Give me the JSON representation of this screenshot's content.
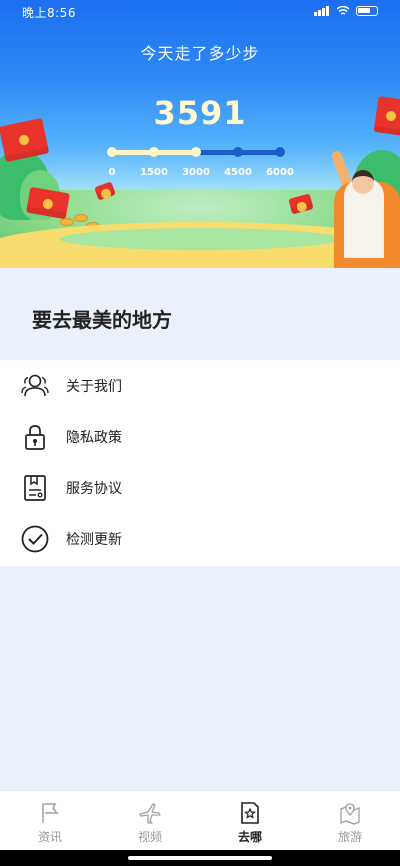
{
  "status_bar": {
    "time": "晚上8:56"
  },
  "hero": {
    "title": "今天走了多少步",
    "step_count": "3591",
    "progress": {
      "current_steps": 3591,
      "milestones": [
        "0",
        "1500",
        "3000",
        "4500",
        "6000"
      ],
      "reached_color": "#fff6c8",
      "unreached_color": "#1a5fc9"
    }
  },
  "section": {
    "title": "要去最美的地方"
  },
  "menu": {
    "items": [
      {
        "label": "关于我们",
        "icon": "users-icon"
      },
      {
        "label": "隐私政策",
        "icon": "lock-icon"
      },
      {
        "label": "服务协议",
        "icon": "document-icon"
      },
      {
        "label": "检测更新",
        "icon": "check-circle-icon"
      }
    ]
  },
  "tabbar": {
    "tabs": [
      {
        "label": "资讯",
        "icon": "flag-icon",
        "active": false
      },
      {
        "label": "视频",
        "icon": "airplane-icon",
        "active": false
      },
      {
        "label": "去哪",
        "icon": "star-note-icon",
        "active": true
      },
      {
        "label": "旅游",
        "icon": "map-pin-icon",
        "active": false
      }
    ]
  },
  "colors": {
    "hero_top": "#1c6ff0",
    "page_background": "#eaf1fd",
    "step_count": "#fff9d2",
    "text_primary": "#222222",
    "tab_inactive": "#9a9a9a"
  }
}
